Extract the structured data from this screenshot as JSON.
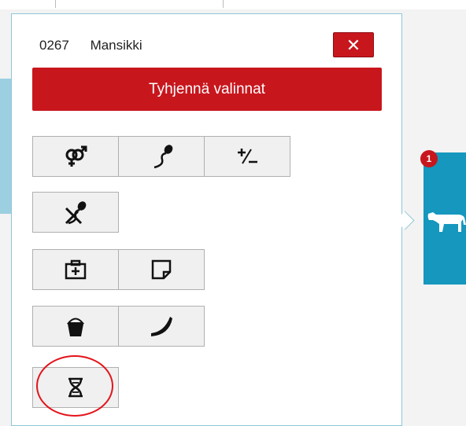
{
  "animal": {
    "id": "0267",
    "name": "Mansikki"
  },
  "close_label": "✕",
  "clear_label": "Tyhjennä valinnat",
  "side_badge": "1",
  "icons": {
    "gender": "gender-symbol-icon",
    "insemination": "sperm-icon",
    "plus_minus": "plus-minus-icon",
    "no_insemination": "no-insemination-icon",
    "medical": "medical-kit-icon",
    "note": "note-icon",
    "bucket": "bucket-icon",
    "horn": "horn-icon",
    "dna": "dna-hourglass-icon",
    "cow": "cow-icon"
  },
  "colors": {
    "accent_red": "#c8161d",
    "side_panel": "#1597be"
  }
}
